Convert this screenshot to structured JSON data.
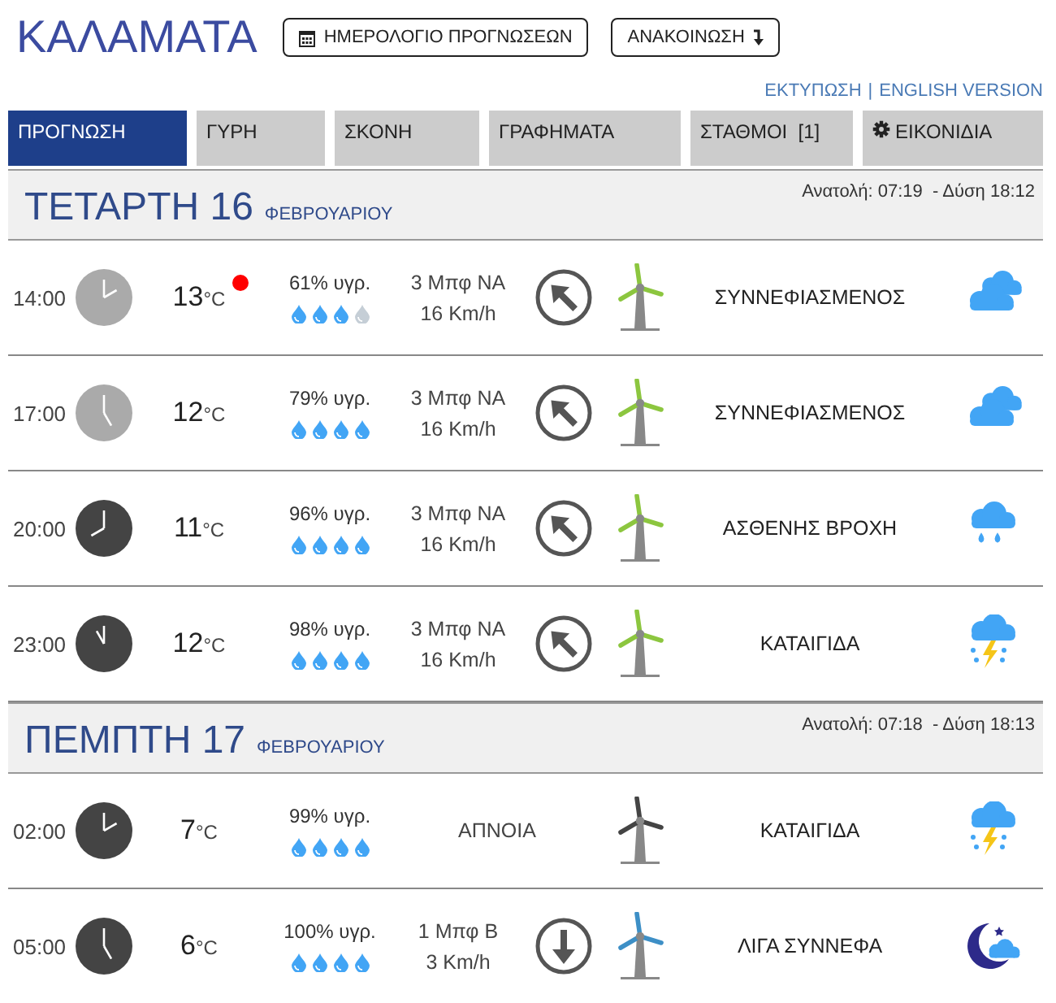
{
  "header": {
    "city": "ΚΑΛΑΜΑΤΑ",
    "buttons": [
      {
        "label": "ΗΜΕΡΟΛΟΓΙΟ ΠΡΟΓΝΩΣΕΩΝ",
        "kind": "calendar"
      },
      {
        "label": "ΑΝΑΚΟΙΝΩΣΗ",
        "kind": "notice"
      }
    ],
    "links": [
      "ΕΚΤΥΠΩΣΗ",
      "ENGLISH VERSION"
    ],
    "link_separator": "|"
  },
  "tabs": [
    {
      "label": "ΠΡΟΓΝΩΣΗ",
      "selected": true
    },
    {
      "label": "ΓΥΡΗ",
      "selected": false
    },
    {
      "label": "ΣΚΟΝΗ",
      "selected": false
    },
    {
      "label": "ΓΡΑΦΗΜΑΤΑ",
      "selected": false
    },
    {
      "label": "ΣΤΑΘΜΟΙ  [1]",
      "selected": false
    },
    {
      "label": "ΕΙΚΟΝΙΔΙΑ",
      "selected": false,
      "kind": "gear"
    }
  ],
  "days": [
    {
      "title": "ΤΕΤΑΡΤΗ 16",
      "month": "ΦΕΒΡΟΥΑΡΙΟΥ",
      "sun": "Ανατολή: 07:19  - Δύση 18:12",
      "rows": [
        {
          "time": "14:00",
          "clock": {
            "kind": "day"
          },
          "temp": "13",
          "unit": "°C",
          "alert": true,
          "humidity": "61% υγρ.",
          "drops": [
            {
              "filled": true
            },
            {
              "filled": true
            },
            {
              "filled": true
            },
            {
              "filled": false
            }
          ],
          "wind": {
            "kind": "northwest",
            "lines": [
              "3 Μπφ ΝΑ",
              "16 Km/h"
            ]
          },
          "color": "#8cc63f",
          "description": "ΣΥΝΝΕΦΙΑΣΜΕΝΟΣ",
          "kind": "cloudy"
        },
        {
          "time": "17:00",
          "clock": {
            "kind": "day"
          },
          "temp": "12",
          "unit": "°C",
          "alert": false,
          "humidity": "79% υγρ.",
          "drops": [
            {
              "filled": true
            },
            {
              "filled": true
            },
            {
              "filled": true
            },
            {
              "filled": true
            }
          ],
          "wind": {
            "kind": "northwest",
            "lines": [
              "3 Μπφ ΝΑ",
              "16 Km/h"
            ]
          },
          "color": "#8cc63f",
          "description": "ΣΥΝΝΕΦΙΑΣΜΕΝΟΣ",
          "kind": "cloudy"
        },
        {
          "time": "20:00",
          "clock": {
            "kind": "night"
          },
          "temp": "11",
          "unit": "°C",
          "alert": false,
          "humidity": "96% υγρ.",
          "drops": [
            {
              "filled": true
            },
            {
              "filled": true
            },
            {
              "filled": true
            },
            {
              "filled": true
            }
          ],
          "wind": {
            "kind": "northwest",
            "lines": [
              "3 Μπφ ΝΑ",
              "16 Km/h"
            ]
          },
          "color": "#8cc63f",
          "description": "ΑΣΘΕΝΗΣ ΒΡΟΧΗ",
          "kind": "rain"
        },
        {
          "time": "23:00",
          "clock": {
            "kind": "night"
          },
          "temp": "12",
          "unit": "°C",
          "alert": false,
          "humidity": "98% υγρ.",
          "drops": [
            {
              "filled": true
            },
            {
              "filled": true
            },
            {
              "filled": true
            },
            {
              "filled": true
            }
          ],
          "wind": {
            "kind": "northwest",
            "lines": [
              "3 Μπφ ΝΑ",
              "16 Km/h"
            ]
          },
          "color": "#8cc63f",
          "description": "ΚΑΤΑΙΓΙΔΑ",
          "kind": "storm"
        }
      ]
    },
    {
      "title": "ΠΕΜΠΤΗ 17",
      "month": "ΦΕΒΡΟΥΑΡΙΟΥ",
      "sun": "Ανατολή: 07:18  - Δύση 18:13",
      "rows": [
        {
          "time": "02:00",
          "clock": {
            "kind": "night"
          },
          "temp": "7",
          "unit": "°C",
          "alert": false,
          "humidity": "99% υγρ.",
          "drops": [
            {
              "filled": true
            },
            {
              "filled": true
            },
            {
              "filled": true
            },
            {
              "filled": true
            }
          ],
          "wind": {
            "kind": "calm",
            "lines": [
              "ΑΠΝΟΙΑ"
            ]
          },
          "color": "#444444",
          "description": "ΚΑΤΑΙΓΙΔΑ",
          "kind": "storm"
        },
        {
          "time": "05:00",
          "clock": {
            "kind": "night"
          },
          "temp": "6",
          "unit": "°C",
          "alert": false,
          "humidity": "100% υγρ.",
          "drops": [
            {
              "filled": true
            },
            {
              "filled": true
            },
            {
              "filled": true
            },
            {
              "filled": true
            }
          ],
          "wind": {
            "kind": "south",
            "lines": [
              "1 Μπφ Β",
              "3 Km/h"
            ]
          },
          "color": "#3d8fc6",
          "description": "ΛΙΓΑ ΣΥΝΝΕΦΑ",
          "kind": "night-cloudy"
        }
      ]
    }
  ]
}
